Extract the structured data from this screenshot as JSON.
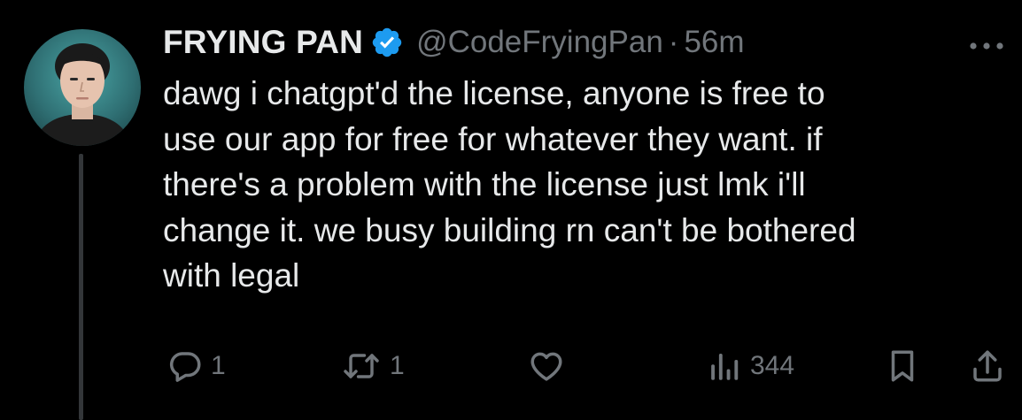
{
  "author": {
    "display_name": "FRYING PAN",
    "handle": "@CodeFryingPan",
    "separator": "·",
    "time": "56m",
    "verified": true
  },
  "tweet": {
    "text": "dawg i chatgpt'd the license, anyone is free to\nuse our app for free for whatever they want. if\nthere's a problem with the license just lmk i'll\nchange it. we busy building rn can't be bothered\nwith legal"
  },
  "actions": {
    "replies": "1",
    "reposts": "1",
    "views": "344"
  },
  "colors": {
    "background": "#000000",
    "text": "#e7e9ea",
    "muted": "#71767b",
    "verified": "#1d9bf0",
    "thread_line": "#333639"
  },
  "icons": {
    "avatar": "profile-photo",
    "verified": "verified-badge-icon",
    "more": "more-dots-icon",
    "reply": "reply-bubble-icon",
    "repost": "repost-arrows-icon",
    "like": "heart-icon",
    "views": "bar-chart-icon",
    "bookmark": "bookmark-icon",
    "share": "share-upload-icon"
  }
}
